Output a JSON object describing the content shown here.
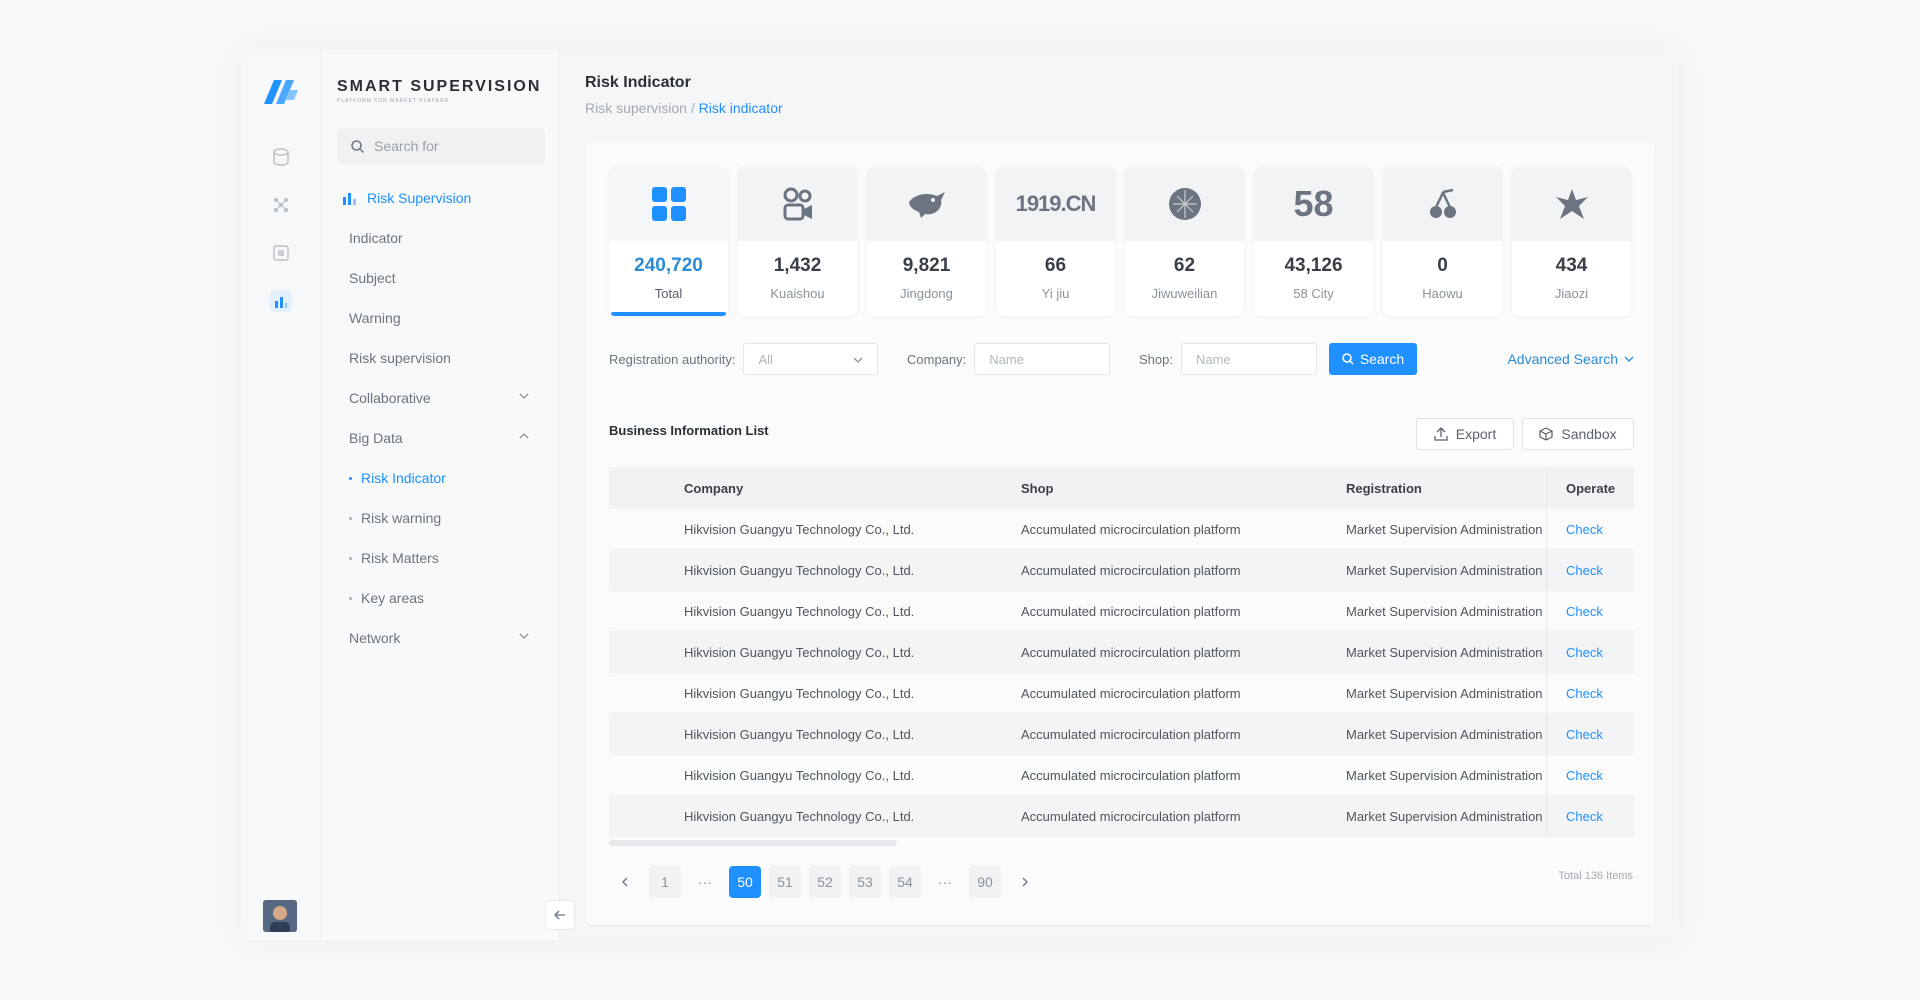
{
  "brand": {
    "title": "SMART SUPERVISION",
    "subtitle": "PLATFORM FOR MARKET PLAYERS"
  },
  "search": {
    "placeholder": "Search for"
  },
  "sidebar": {
    "items": [
      {
        "label": "Risk Supervision"
      },
      {
        "label": "Indicator"
      },
      {
        "label": "Subject"
      },
      {
        "label": "Warning"
      },
      {
        "label": "Risk supervision"
      },
      {
        "label": "Collaborative"
      },
      {
        "label": "Big Data"
      },
      {
        "label": "Risk Indicator"
      },
      {
        "label": "Risk warning"
      },
      {
        "label": "Risk Matters"
      },
      {
        "label": "Key areas"
      },
      {
        "label": "Network"
      }
    ]
  },
  "header": {
    "title": "Risk Indicator",
    "breadcrumb_parent": "Risk supervision",
    "breadcrumb_sep": " / ",
    "breadcrumb_current": "Risk indicator"
  },
  "cards": [
    {
      "value": "240,720",
      "label": "Total",
      "icon": "grid-icon"
    },
    {
      "value": "1,432",
      "label": "Kuaishou",
      "icon": "kuaishou-icon"
    },
    {
      "value": "9,821",
      "label": "Jingdong",
      "icon": "jingdong-icon"
    },
    {
      "value": "66",
      "label": "Yi jiu",
      "logo_text": "1919.CN"
    },
    {
      "value": "62",
      "label": "Jiwuweilian",
      "icon": "globe-icon"
    },
    {
      "value": "43,126",
      "label": "58 City",
      "logo_text": "58"
    },
    {
      "value": "0",
      "label": "Haowu",
      "icon": "cherry-icon"
    },
    {
      "value": "434",
      "label": "Jiaozi",
      "icon": "star-icon"
    }
  ],
  "filters": {
    "authority_label": "Registration authority:",
    "authority_value": "All",
    "company_label": "Company:",
    "company_placeholder": "Name",
    "shop_label": "Shop:",
    "shop_placeholder": "Name",
    "search_button": "Search",
    "advanced": "Advanced Search"
  },
  "list": {
    "title": "Business Information List",
    "export_button": "Export",
    "sandbox_button": "Sandbox",
    "columns": {
      "company": "Company",
      "shop": "Shop",
      "registration": "Registration",
      "operate": "Operate"
    },
    "rows": [
      {
        "company": "Hikvision Guangyu Technology Co., Ltd.",
        "shop": "Accumulated microcirculation platform",
        "registration": "Market Supervision Administration",
        "operate": "Check"
      },
      {
        "company": "Hikvision Guangyu Technology Co., Ltd.",
        "shop": "Accumulated microcirculation platform",
        "registration": "Market Supervision Administration",
        "operate": "Check"
      },
      {
        "company": "Hikvision Guangyu Technology Co., Ltd.",
        "shop": "Accumulated microcirculation platform",
        "registration": "Market Supervision Administration",
        "operate": "Check"
      },
      {
        "company": "Hikvision Guangyu Technology Co., Ltd.",
        "shop": "Accumulated microcirculation platform",
        "registration": "Market Supervision Administration",
        "operate": "Check"
      },
      {
        "company": "Hikvision Guangyu Technology Co., Ltd.",
        "shop": "Accumulated microcirculation platform",
        "registration": "Market Supervision Administration",
        "operate": "Check"
      },
      {
        "company": "Hikvision Guangyu Technology Co., Ltd.",
        "shop": "Accumulated microcirculation platform",
        "registration": "Market Supervision Administration",
        "operate": "Check"
      },
      {
        "company": "Hikvision Guangyu Technology Co., Ltd.",
        "shop": "Accumulated microcirculation platform",
        "registration": "Market Supervision Administration",
        "operate": "Check"
      },
      {
        "company": "Hikvision Guangyu Technology Co., Ltd.",
        "shop": "Accumulated microcirculation platform",
        "registration": "Market Supervision Administration",
        "operate": "Check"
      }
    ]
  },
  "pagination": {
    "pages": [
      "1",
      "···",
      "50",
      "51",
      "52",
      "53",
      "54",
      "···",
      "90"
    ],
    "current": "50",
    "total": "Total 136 Items"
  },
  "colors": {
    "accent": "#1e90ff",
    "text": "#333333",
    "muted": "#8a929b"
  }
}
